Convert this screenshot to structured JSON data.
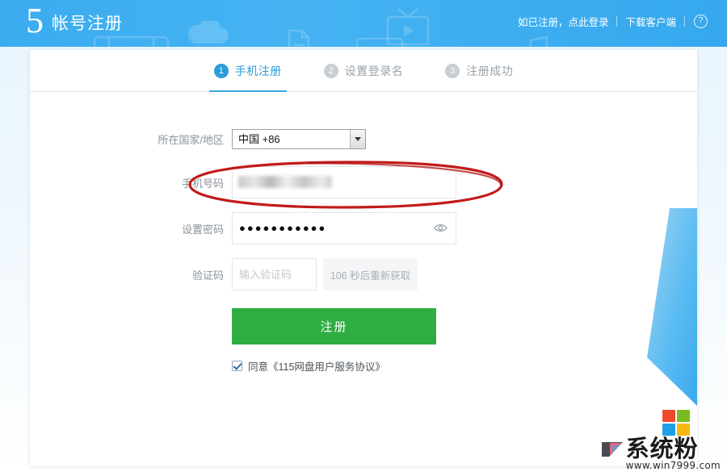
{
  "header": {
    "logo_text": "5",
    "logo_icon": "number-five-logo",
    "title": "帐号注册",
    "links": [
      {
        "label": "如已注册，点此登录",
        "name": "login-link"
      },
      {
        "label": "下载客户端",
        "name": "download-client-link"
      }
    ],
    "help_icon_glyph": "?",
    "background_color": "#3fb0f0",
    "deco_icons": [
      "film-icon",
      "cloud-icon",
      "document-icon",
      "image-icon",
      "tv-play-icon",
      "music-note-icon"
    ]
  },
  "steps": [
    {
      "num": "1",
      "label": "手机注册",
      "state": "active"
    },
    {
      "num": "2",
      "label": "设置登录名",
      "state": "inactive"
    },
    {
      "num": "3",
      "label": "注册成功",
      "state": "inactive"
    }
  ],
  "form": {
    "country": {
      "label": "所在国家/地区",
      "value": "中国 +86",
      "options": [
        "中国 +86"
      ]
    },
    "phone": {
      "label": "手机号码",
      "value": "",
      "placeholder": "",
      "redacted": true
    },
    "password": {
      "label": "设置密码",
      "mask_char": "●",
      "mask_count": 11,
      "masked_value": "●●●●●●●●●●●",
      "toggle_icon": "eye-icon"
    },
    "code": {
      "label": "验证码",
      "value": "",
      "placeholder": "输入验证码",
      "resend_label": "106 秒后重新获取",
      "resend_seconds": "106",
      "resend_disabled": true
    },
    "submit_label": "注册",
    "submit_color": "#2fad41",
    "agreement": {
      "checked": true,
      "label": "同意《115网盘用户服务协议》"
    }
  },
  "annotation": {
    "type": "hand-drawn-ellipse",
    "color": "#c21a1a",
    "target": "phone-number-row"
  },
  "watermark": {
    "brand": "系统粉",
    "url": "www.win7999.com",
    "tile_colors": [
      "#ef4a28",
      "#7cbb1f",
      "#1fa0e5",
      "#f9b713"
    ]
  },
  "colors": {
    "accent_blue": "#2d9cdb",
    "header_blue": "#3fb0f0",
    "green": "#2fad41",
    "annotation_red": "#c21a1a"
  }
}
